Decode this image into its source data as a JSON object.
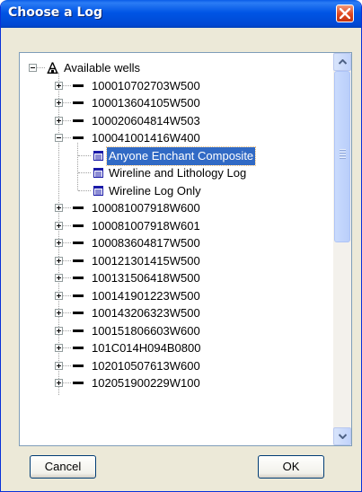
{
  "window": {
    "title": "Choose a Log"
  },
  "tree": {
    "root_label": "Available wells",
    "wells_before": [
      "100010702703W500",
      "100013604105W500",
      "100020604814W503"
    ],
    "expanded_well": "100041001416W400",
    "logs": [
      "Anyone Enchant Composite",
      "Wireline and Lithology Log",
      "Wireline Log Only"
    ],
    "selected_log": "Anyone Enchant Composite",
    "wells_after": [
      "100081007918W600",
      "100081007918W601",
      "100083604817W500",
      "100121301415W500",
      "100131506418W500",
      "100141901223W500",
      "100143206323W500",
      "100151806603W600",
      "101C014H094B0800",
      "102010507613W600",
      "102051900229W100"
    ]
  },
  "buttons": {
    "cancel": "Cancel",
    "ok": "OK"
  },
  "colors": {
    "selection": "#316ac5",
    "titlebar": "#0055e5",
    "close": "#e0471f"
  },
  "icons": {
    "root": "well-rig-icon",
    "well": "well-dash-icon",
    "log": "log-document-icon"
  }
}
